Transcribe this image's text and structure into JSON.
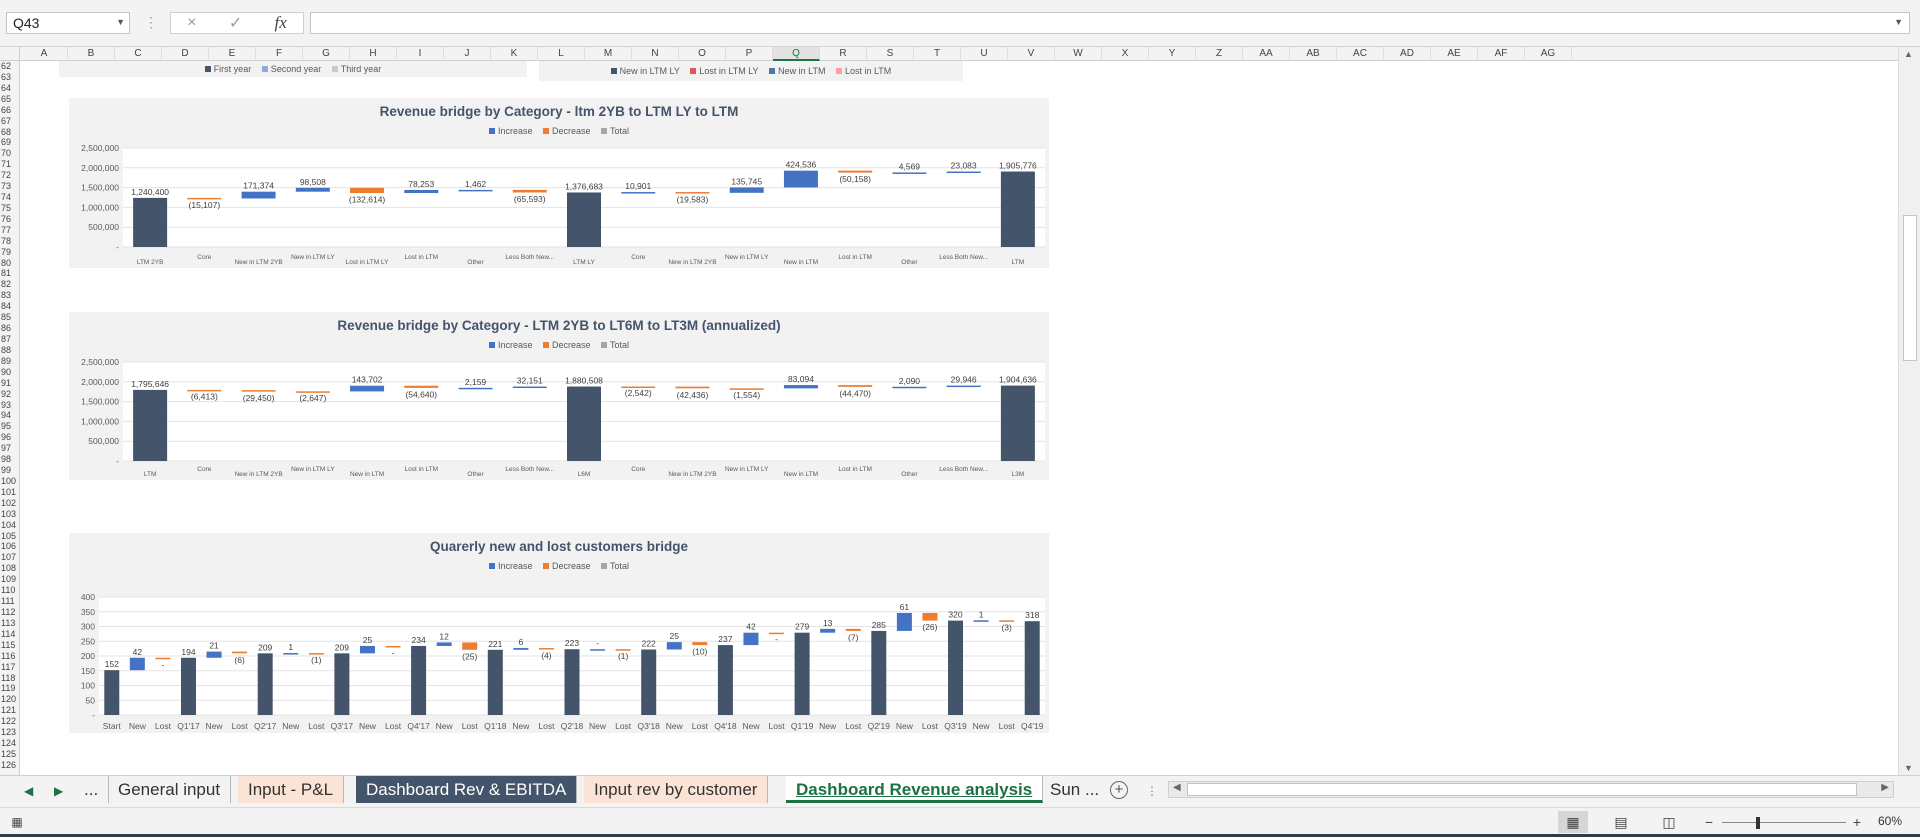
{
  "formula_bar": {
    "name_box": "Q43",
    "cancel_icon": "×",
    "enter_icon": "✓",
    "fx": "fx",
    "formula": ""
  },
  "columns": [
    "A",
    "B",
    "C",
    "D",
    "E",
    "F",
    "G",
    "H",
    "I",
    "J",
    "K",
    "L",
    "M",
    "N",
    "O",
    "P",
    "Q",
    "R",
    "S",
    "T",
    "U",
    "V",
    "W",
    "X",
    "Y",
    "Z",
    "AA",
    "AB",
    "AC",
    "AD",
    "AE",
    "AF",
    "AG"
  ],
  "selected_column": "Q",
  "rows": [
    "62",
    "63",
    "64",
    "65",
    "66",
    "67",
    "68",
    "69",
    "70",
    "71",
    "72",
    "73",
    "74",
    "75",
    "76",
    "77",
    "78",
    "79",
    "80",
    "81",
    "82",
    "83",
    "84",
    "85",
    "86",
    "87",
    "88",
    "89",
    "90",
    "91",
    "92",
    "93",
    "94",
    "95",
    "96",
    "97",
    "98",
    "99",
    "100",
    "101",
    "102",
    "103",
    "104",
    "105",
    "106",
    "107",
    "108",
    "109",
    "110",
    "111",
    "112",
    "113",
    "114",
    "115",
    "116",
    "117",
    "118",
    "119",
    "120",
    "121",
    "122",
    "123",
    "124",
    "125",
    "126"
  ],
  "top_legends": {
    "left": [
      "First year",
      "Second year",
      "Third year"
    ],
    "right": [
      "New in LTM LY",
      "Lost in LTM LY",
      "New in LTM",
      "Lost in LTM"
    ]
  },
  "charts": {
    "legend": [
      "Increase",
      "Decrease",
      "Total"
    ],
    "colors": {
      "increase": "#4472c4",
      "decrease": "#ed7d31",
      "total": "#44546a"
    },
    "chart1": {
      "title": "Revenue bridge by Category - ltm 2YB to LTM LY to LTM",
      "ticks": [
        "2,500,000",
        "2,000,000",
        "1,500,000",
        "1,000,000",
        "500,000",
        "-"
      ]
    },
    "chart2": {
      "title": "Revenue bridge by Category - LTM 2YB to LT6M  to LT3M (annualized)",
      "ticks": [
        "2,500,000",
        "2,000,000",
        "1,500,000",
        "1,000,000",
        "500,000",
        "-"
      ]
    },
    "chart3": {
      "title": "Quarerly new and lost customers bridge",
      "ticks": [
        "400",
        "350",
        "300",
        "250",
        "200",
        "150",
        "100",
        "50",
        "-"
      ]
    }
  },
  "chart_data": [
    {
      "type": "bar",
      "title": "Revenue bridge by Category - ltm 2YB to LTM LY to LTM",
      "ylim": [
        0,
        2500000
      ],
      "categories": [
        "LTM 2YB",
        "Core",
        "New in LTM 2YB",
        "New in LTM LY",
        "Lost in LTM LY",
        "Lost in LTM",
        "Other",
        "Less Both New...",
        "LTM LY",
        "Core",
        "New in LTM 2YB",
        "New in LTM LY",
        "New in LTM",
        "Lost in LTM",
        "Other",
        "Less Both New...",
        "LTM"
      ],
      "kinds": [
        "total",
        "dec",
        "inc",
        "inc",
        "dec",
        "inc",
        "inc",
        "dec",
        "total",
        "inc",
        "dec",
        "inc",
        "inc",
        "dec",
        "inc",
        "inc",
        "total"
      ],
      "values": [
        1240400,
        -15107,
        171374,
        98508,
        -132614,
        78253,
        1462,
        -65593,
        1376683,
        10901,
        -19583,
        135745,
        424536,
        -50158,
        4569,
        23083,
        1905776
      ],
      "labels": [
        "1,240,400",
        "(15,107)",
        "171,374",
        "98,508",
        "(132,614)",
        "78,253",
        "1,462",
        "(65,593)",
        "1,376,683",
        "10,901",
        "(19,583)",
        "135,745",
        "424,536",
        "(50,158)",
        "4,569",
        "23,083",
        "1,905,776"
      ]
    },
    {
      "type": "bar",
      "title": "Revenue bridge by Category - LTM 2YB to LT6M  to LT3M (annualized)",
      "ylim": [
        0,
        2500000
      ],
      "categories": [
        "LTM",
        "Core",
        "New in LTM 2YB",
        "New in LTM LY",
        "New in LTM",
        "Lost in LTM",
        "Other",
        "Less Both New...",
        "L6M",
        "Core",
        "New in LTM 2YB",
        "New in LTM LY",
        "New in LTM",
        "Lost in LTM",
        "Other",
        "Less Both New...",
        "L3M"
      ],
      "kinds": [
        "total",
        "dec",
        "dec",
        "dec",
        "inc",
        "dec",
        "inc",
        "inc",
        "total",
        "dec",
        "dec",
        "dec",
        "inc",
        "dec",
        "inc",
        "inc",
        "total"
      ],
      "values": [
        1795646,
        -6413,
        -29450,
        -2647,
        143702,
        -54640,
        2159,
        32151,
        1880508,
        -2542,
        -42436,
        -1554,
        83094,
        -44470,
        2090,
        29946,
        1904636
      ],
      "labels": [
        "1,795,646",
        "(6,413)",
        "(29,450)",
        "(2,647)",
        "143,702",
        "(54,640)",
        "2,159",
        "32,151",
        "1,880,508",
        "(2,542)",
        "(42,436)",
        "(1,554)",
        "83,094",
        "(44,470)",
        "2,090",
        "29,946",
        "1,904,636"
      ]
    },
    {
      "type": "bar",
      "title": "Quarerly new and lost customers bridge",
      "ylim": [
        0,
        400
      ],
      "categories": [
        "Start",
        "New",
        "Lost",
        "Q1'17",
        "New",
        "Lost",
        "Q2'17",
        "New",
        "Lost",
        "Q3'17",
        "New",
        "Lost",
        "Q4'17",
        "New",
        "Lost",
        "Q1'18",
        "New",
        "Lost",
        "Q2'18",
        "New",
        "Lost",
        "Q3'18",
        "New",
        "Lost",
        "Q4'18",
        "New",
        "Lost",
        "Q1'19",
        "New",
        "Lost",
        "Q2'19",
        "New",
        "Lost",
        "Q3'19",
        "New",
        "Lost",
        "Q4'19"
      ],
      "kinds": [
        "total",
        "inc",
        "dec",
        "total",
        "inc",
        "dec",
        "total",
        "inc",
        "dec",
        "total",
        "inc",
        "dec",
        "total",
        "inc",
        "dec",
        "total",
        "inc",
        "dec",
        "total",
        "inc",
        "dec",
        "total",
        "inc",
        "dec",
        "total",
        "inc",
        "dec",
        "total",
        "inc",
        "dec",
        "total",
        "inc",
        "dec",
        "total",
        "inc",
        "dec",
        "total"
      ],
      "values": [
        152,
        42,
        0,
        194,
        21,
        -6,
        209,
        1,
        -1,
        209,
        25,
        0,
        234,
        12,
        -25,
        221,
        6,
        -4,
        223,
        0,
        -1,
        222,
        25,
        -10,
        237,
        42,
        0,
        279,
        13,
        -7,
        285,
        61,
        -26,
        320,
        1,
        -3,
        318
      ],
      "labels": [
        "152",
        "42",
        "-",
        "194",
        "21",
        "(6)",
        "209",
        "1",
        "(1)",
        "209",
        "25",
        "-",
        "234",
        "12",
        "(25)",
        "221",
        "6",
        "(4)",
        "223",
        "-",
        "(1)",
        "222",
        "25",
        "(10)",
        "237",
        "42",
        "-",
        "279",
        "13",
        "(7)",
        "285",
        "61",
        "(26)",
        "320",
        "1",
        "(3)",
        "318"
      ]
    }
  ],
  "sheet_tabs": [
    "...",
    "General input",
    "Input - P&L",
    "Dashboard Rev & EBITDA",
    "Input rev by customer",
    "Dashboard Revenue analysis",
    "Sun ..."
  ],
  "active_tab": "Dashboard Revenue analysis",
  "status": {
    "zoom": "60%"
  }
}
